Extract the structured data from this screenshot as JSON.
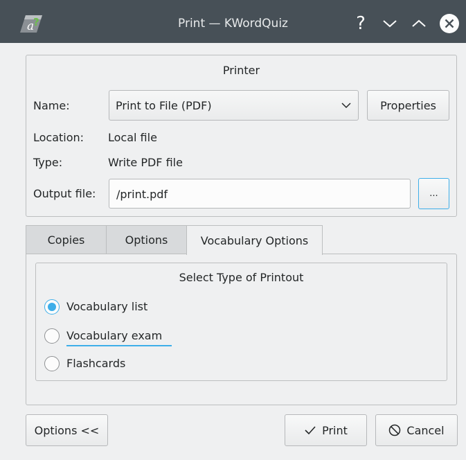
{
  "window": {
    "title": "Print — KWordQuiz",
    "help_glyph": "?"
  },
  "printer": {
    "group_title": "Printer",
    "name_label": "Name:",
    "name_value": "Print to File (PDF)",
    "properties_label": "Properties",
    "location_label": "Location:",
    "location_value": "Local file",
    "type_label": "Type:",
    "type_value": "Write PDF file",
    "output_label": "Output file:",
    "output_value": "/print.pdf",
    "browse_label": "..."
  },
  "tabs": [
    {
      "label": "Copies"
    },
    {
      "label": "Options"
    },
    {
      "label": "Vocabulary Options"
    }
  ],
  "printout": {
    "group_title": "Select Type of Printout",
    "options": [
      {
        "label": "Vocabulary list",
        "checked": true
      },
      {
        "label": "Vocabulary exam",
        "checked": false
      },
      {
        "label": "Flashcards",
        "checked": false
      }
    ]
  },
  "buttons": {
    "options_toggle": "Options <<",
    "print": "Print",
    "cancel": "Cancel"
  },
  "colors": {
    "titlebar": "#475057",
    "accent": "#3daee9",
    "window_bg": "#eff0f1"
  }
}
